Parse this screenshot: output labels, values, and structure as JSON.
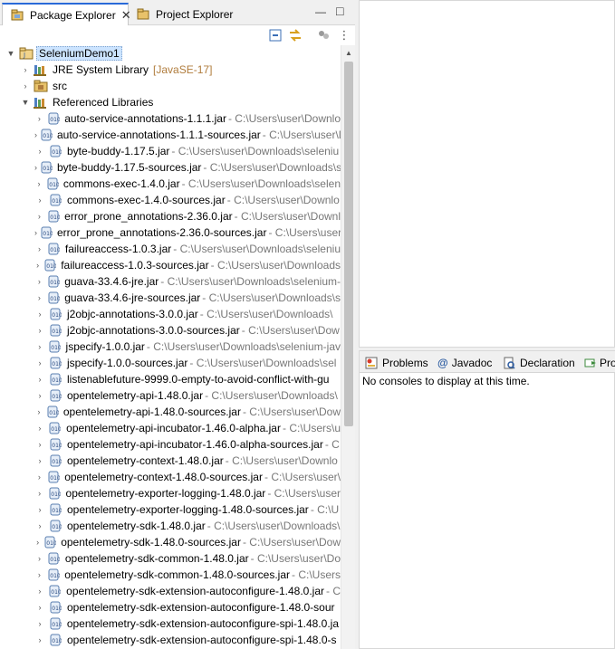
{
  "left_view": {
    "tabs": [
      {
        "label": "Package Explorer",
        "close": "✕"
      },
      {
        "label": "Project Explorer"
      }
    ],
    "minimize_glyph": "—",
    "maximize_glyph": "□",
    "menu_glyph": "⋮"
  },
  "tree": {
    "project": "SeleniumDemo1",
    "jre": {
      "label": "JRE System Library",
      "decoration": "[JavaSE-17]"
    },
    "src": "src",
    "ref_libs": "Referenced Libraries",
    "jars": [
      {
        "name": "auto-service-annotations-1.1.1.jar",
        "path": " - C:\\Users\\user\\Downlo"
      },
      {
        "name": "auto-service-annotations-1.1.1-sources.jar",
        "path": " - C:\\Users\\user\\Dow"
      },
      {
        "name": "byte-buddy-1.17.5.jar",
        "path": " - C:\\Users\\user\\Downloads\\seleniu"
      },
      {
        "name": "byte-buddy-1.17.5-sources.jar",
        "path": " - C:\\Users\\user\\Downloads\\s"
      },
      {
        "name": "commons-exec-1.4.0.jar",
        "path": " - C:\\Users\\user\\Downloads\\selen"
      },
      {
        "name": "commons-exec-1.4.0-sources.jar",
        "path": " - C:\\Users\\user\\Downlo"
      },
      {
        "name": "error_prone_annotations-2.36.0.jar",
        "path": " - C:\\Users\\user\\Downl"
      },
      {
        "name": "error_prone_annotations-2.36.0-sources.jar",
        "path": " - C:\\Users\\user"
      },
      {
        "name": "failureaccess-1.0.3.jar",
        "path": " - C:\\Users\\user\\Downloads\\seleniu"
      },
      {
        "name": "failureaccess-1.0.3-sources.jar",
        "path": " - C:\\Users\\user\\Downloads"
      },
      {
        "name": "guava-33.4.6-jre.jar",
        "path": " - C:\\Users\\user\\Downloads\\selenium-"
      },
      {
        "name": "guava-33.4.6-jre-sources.jar",
        "path": " - C:\\Users\\user\\Downloads\\s"
      },
      {
        "name": "j2objc-annotations-3.0.0.jar",
        "path": " - C:\\Users\\user\\Downloads\\"
      },
      {
        "name": "j2objc-annotations-3.0.0-sources.jar",
        "path": " - C:\\Users\\user\\Dow"
      },
      {
        "name": "jspecify-1.0.0.jar",
        "path": " - C:\\Users\\user\\Downloads\\selenium-jav"
      },
      {
        "name": "jspecify-1.0.0-sources.jar",
        "path": " - C:\\Users\\user\\Downloads\\sel"
      },
      {
        "name": "listenablefuture-9999.0-empty-to-avoid-conflict-with-gu",
        "path": ""
      },
      {
        "name": "opentelemetry-api-1.48.0.jar",
        "path": " - C:\\Users\\user\\Downloads\\"
      },
      {
        "name": "opentelemetry-api-1.48.0-sources.jar",
        "path": " - C:\\Users\\user\\Dow"
      },
      {
        "name": "opentelemetry-api-incubator-1.46.0-alpha.jar",
        "path": " - C:\\Users\\u"
      },
      {
        "name": "opentelemetry-api-incubator-1.46.0-alpha-sources.jar",
        "path": " - C"
      },
      {
        "name": "opentelemetry-context-1.48.0.jar",
        "path": " - C:\\Users\\user\\Downlo"
      },
      {
        "name": "opentelemetry-context-1.48.0-sources.jar",
        "path": " - C:\\Users\\user\\"
      },
      {
        "name": "opentelemetry-exporter-logging-1.48.0.jar",
        "path": " - C:\\Users\\user"
      },
      {
        "name": "opentelemetry-exporter-logging-1.48.0-sources.jar",
        "path": " - C:\\U"
      },
      {
        "name": "opentelemetry-sdk-1.48.0.jar",
        "path": " - C:\\Users\\user\\Downloads\\"
      },
      {
        "name": "opentelemetry-sdk-1.48.0-sources.jar",
        "path": " - C:\\Users\\user\\Dow"
      },
      {
        "name": "opentelemetry-sdk-common-1.48.0.jar",
        "path": " - C:\\Users\\user\\Do"
      },
      {
        "name": "opentelemetry-sdk-common-1.48.0-sources.jar",
        "path": " - C:\\Users"
      },
      {
        "name": "opentelemetry-sdk-extension-autoconfigure-1.48.0.jar",
        "path": " - C"
      },
      {
        "name": "opentelemetry-sdk-extension-autoconfigure-1.48.0-sour",
        "path": ""
      },
      {
        "name": "opentelemetry-sdk-extension-autoconfigure-spi-1.48.0.ja",
        "path": ""
      },
      {
        "name": "opentelemetry-sdk-extension-autoconfigure-spi-1.48.0-s",
        "path": ""
      }
    ]
  },
  "bottom_panel": {
    "tabs": [
      {
        "label": "Problems"
      },
      {
        "label": "Javadoc",
        "glyph": "@"
      },
      {
        "label": "Declaration"
      },
      {
        "label": "Pro"
      }
    ],
    "message": "No consoles to display at this time."
  },
  "colors": {
    "accent": "#2a6ad8",
    "selection": "#cce4ff",
    "decoration": "#b07c3c",
    "path_gray": "#777777"
  }
}
